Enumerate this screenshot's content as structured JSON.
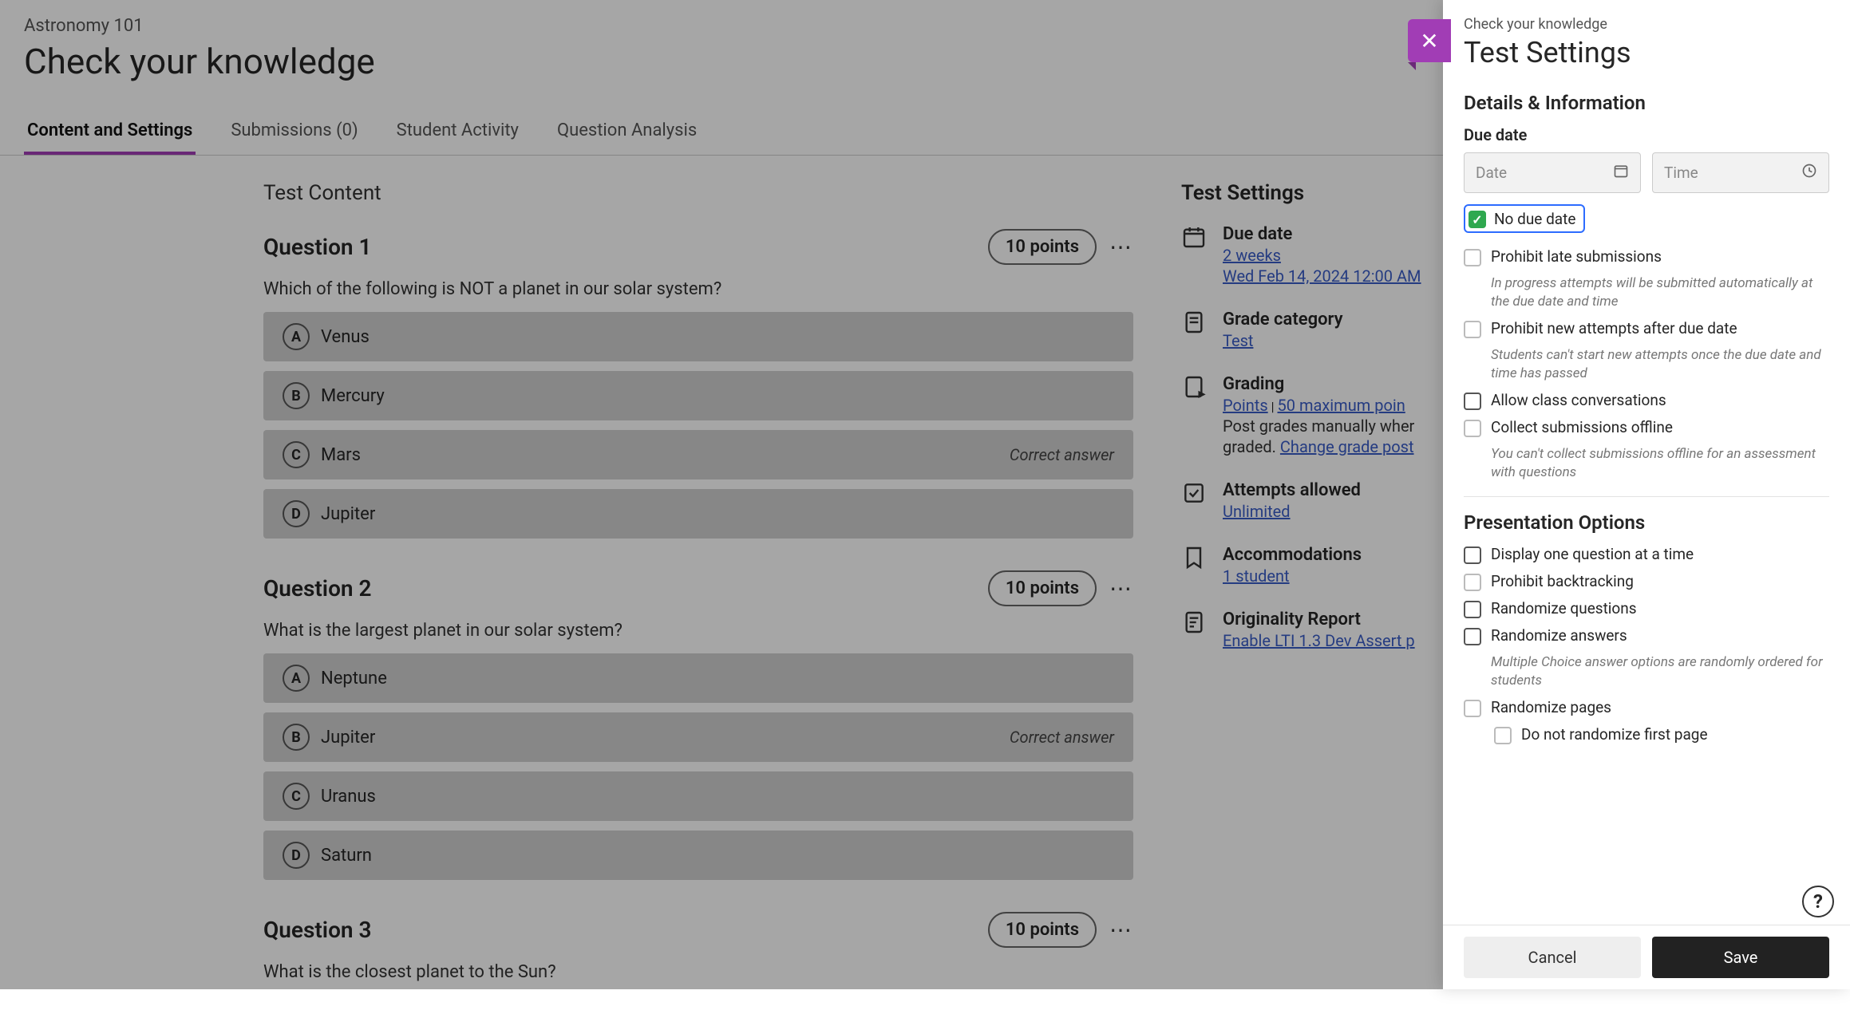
{
  "header": {
    "breadcrumb": "Astronomy 101",
    "title": "Check your knowledge"
  },
  "tabs": {
    "content": "Content and Settings",
    "submissions": "Submissions (0)",
    "activity": "Student Activity",
    "analysis": "Question Analysis"
  },
  "main": {
    "section_title": "Test Content",
    "points_suffix": "points",
    "correct_label": "Correct answer",
    "q1": {
      "title": "Question 1",
      "points": "10",
      "prompt": "Which of the following is NOT a planet in our solar system?",
      "a": "Venus",
      "b": "Mercury",
      "c": "Mars",
      "d": "Jupiter",
      "correct": "c"
    },
    "q2": {
      "title": "Question 2",
      "points": "10",
      "prompt": "What is the largest planet in our solar system?",
      "a": "Neptune",
      "b": "Jupiter",
      "c": "Uranus",
      "d": "Saturn",
      "correct": "b"
    },
    "q3": {
      "title": "Question 3",
      "points": "10",
      "prompt": "What is the closest planet to the Sun?"
    }
  },
  "side": {
    "title": "Test Settings",
    "due": {
      "label": "Due date",
      "rel": "2 weeks",
      "abs": "Wed Feb 14, 2024 12:00 AM"
    },
    "gradecat": {
      "label": "Grade category",
      "value": "Test"
    },
    "grading": {
      "label": "Grading",
      "pts_lbl": "Points",
      "sep": " | ",
      "max_lbl": "50 maximum poin",
      "desc1": "Post grades manually wher",
      "desc2": "graded. ",
      "change": "Change grade post"
    },
    "attempts": {
      "label": "Attempts allowed",
      "value": "Unlimited"
    },
    "accom": {
      "label": "Accommodations",
      "value": "1 student"
    },
    "orig": {
      "label": "Originality Report",
      "value": "Enable LTI 1.3 Dev Assert p"
    }
  },
  "panel": {
    "breadcrumb": "Check your knowledge",
    "title": "Test Settings",
    "sect_details": "Details & Information",
    "due_label": "Due date",
    "date_ph": "Date",
    "time_ph": "Time",
    "no_due": "No due date",
    "prohibit_late": "Prohibit late submissions",
    "prohibit_late_help": "In progress attempts will be submitted automatically at the due date and time",
    "prohibit_new": "Prohibit new attempts after due date",
    "prohibit_new_help": "Students can't start new attempts once the due date and time has passed",
    "allow_conv": "Allow class conversations",
    "collect_offline": "Collect submissions offline",
    "collect_offline_help": "You can't collect submissions offline for an assessment with questions",
    "sect_pres": "Presentation Options",
    "one_at_time": "Display one question at a time",
    "backtrack": "Prohibit backtracking",
    "rand_q": "Randomize questions",
    "rand_a": "Randomize answers",
    "rand_a_help": "Multiple Choice answer options are randomly ordered for students",
    "rand_p": "Randomize pages",
    "rand_p_first": "Do not randomize first page",
    "cancel": "Cancel",
    "save": "Save"
  }
}
